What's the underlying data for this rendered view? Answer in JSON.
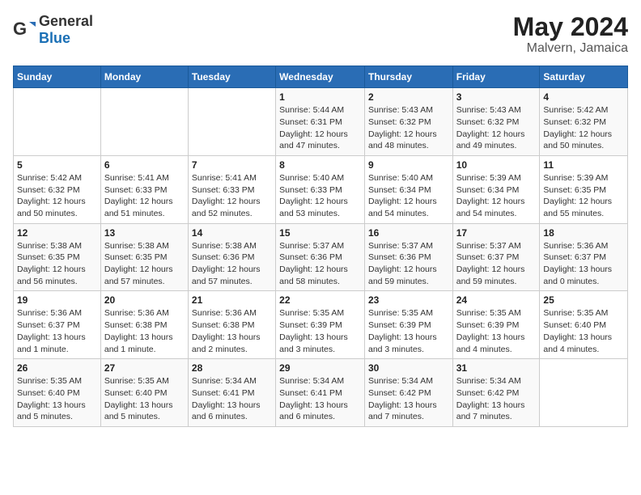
{
  "header": {
    "logo_general": "General",
    "logo_blue": "Blue",
    "month": "May 2024",
    "location": "Malvern, Jamaica"
  },
  "days_of_week": [
    "Sunday",
    "Monday",
    "Tuesday",
    "Wednesday",
    "Thursday",
    "Friday",
    "Saturday"
  ],
  "weeks": [
    [
      {
        "day": "",
        "info": ""
      },
      {
        "day": "",
        "info": ""
      },
      {
        "day": "",
        "info": ""
      },
      {
        "day": "1",
        "info": "Sunrise: 5:44 AM\nSunset: 6:31 PM\nDaylight: 12 hours\nand 47 minutes."
      },
      {
        "day": "2",
        "info": "Sunrise: 5:43 AM\nSunset: 6:32 PM\nDaylight: 12 hours\nand 48 minutes."
      },
      {
        "day": "3",
        "info": "Sunrise: 5:43 AM\nSunset: 6:32 PM\nDaylight: 12 hours\nand 49 minutes."
      },
      {
        "day": "4",
        "info": "Sunrise: 5:42 AM\nSunset: 6:32 PM\nDaylight: 12 hours\nand 50 minutes."
      }
    ],
    [
      {
        "day": "5",
        "info": "Sunrise: 5:42 AM\nSunset: 6:32 PM\nDaylight: 12 hours\nand 50 minutes."
      },
      {
        "day": "6",
        "info": "Sunrise: 5:41 AM\nSunset: 6:33 PM\nDaylight: 12 hours\nand 51 minutes."
      },
      {
        "day": "7",
        "info": "Sunrise: 5:41 AM\nSunset: 6:33 PM\nDaylight: 12 hours\nand 52 minutes."
      },
      {
        "day": "8",
        "info": "Sunrise: 5:40 AM\nSunset: 6:33 PM\nDaylight: 12 hours\nand 53 minutes."
      },
      {
        "day": "9",
        "info": "Sunrise: 5:40 AM\nSunset: 6:34 PM\nDaylight: 12 hours\nand 54 minutes."
      },
      {
        "day": "10",
        "info": "Sunrise: 5:39 AM\nSunset: 6:34 PM\nDaylight: 12 hours\nand 54 minutes."
      },
      {
        "day": "11",
        "info": "Sunrise: 5:39 AM\nSunset: 6:35 PM\nDaylight: 12 hours\nand 55 minutes."
      }
    ],
    [
      {
        "day": "12",
        "info": "Sunrise: 5:38 AM\nSunset: 6:35 PM\nDaylight: 12 hours\nand 56 minutes."
      },
      {
        "day": "13",
        "info": "Sunrise: 5:38 AM\nSunset: 6:35 PM\nDaylight: 12 hours\nand 57 minutes."
      },
      {
        "day": "14",
        "info": "Sunrise: 5:38 AM\nSunset: 6:36 PM\nDaylight: 12 hours\nand 57 minutes."
      },
      {
        "day": "15",
        "info": "Sunrise: 5:37 AM\nSunset: 6:36 PM\nDaylight: 12 hours\nand 58 minutes."
      },
      {
        "day": "16",
        "info": "Sunrise: 5:37 AM\nSunset: 6:36 PM\nDaylight: 12 hours\nand 59 minutes."
      },
      {
        "day": "17",
        "info": "Sunrise: 5:37 AM\nSunset: 6:37 PM\nDaylight: 12 hours\nand 59 minutes."
      },
      {
        "day": "18",
        "info": "Sunrise: 5:36 AM\nSunset: 6:37 PM\nDaylight: 13 hours\nand 0 minutes."
      }
    ],
    [
      {
        "day": "19",
        "info": "Sunrise: 5:36 AM\nSunset: 6:37 PM\nDaylight: 13 hours\nand 1 minute."
      },
      {
        "day": "20",
        "info": "Sunrise: 5:36 AM\nSunset: 6:38 PM\nDaylight: 13 hours\nand 1 minute."
      },
      {
        "day": "21",
        "info": "Sunrise: 5:36 AM\nSunset: 6:38 PM\nDaylight: 13 hours\nand 2 minutes."
      },
      {
        "day": "22",
        "info": "Sunrise: 5:35 AM\nSunset: 6:39 PM\nDaylight: 13 hours\nand 3 minutes."
      },
      {
        "day": "23",
        "info": "Sunrise: 5:35 AM\nSunset: 6:39 PM\nDaylight: 13 hours\nand 3 minutes."
      },
      {
        "day": "24",
        "info": "Sunrise: 5:35 AM\nSunset: 6:39 PM\nDaylight: 13 hours\nand 4 minutes."
      },
      {
        "day": "25",
        "info": "Sunrise: 5:35 AM\nSunset: 6:40 PM\nDaylight: 13 hours\nand 4 minutes."
      }
    ],
    [
      {
        "day": "26",
        "info": "Sunrise: 5:35 AM\nSunset: 6:40 PM\nDaylight: 13 hours\nand 5 minutes."
      },
      {
        "day": "27",
        "info": "Sunrise: 5:35 AM\nSunset: 6:40 PM\nDaylight: 13 hours\nand 5 minutes."
      },
      {
        "day": "28",
        "info": "Sunrise: 5:34 AM\nSunset: 6:41 PM\nDaylight: 13 hours\nand 6 minutes."
      },
      {
        "day": "29",
        "info": "Sunrise: 5:34 AM\nSunset: 6:41 PM\nDaylight: 13 hours\nand 6 minutes."
      },
      {
        "day": "30",
        "info": "Sunrise: 5:34 AM\nSunset: 6:42 PM\nDaylight: 13 hours\nand 7 minutes."
      },
      {
        "day": "31",
        "info": "Sunrise: 5:34 AM\nSunset: 6:42 PM\nDaylight: 13 hours\nand 7 minutes."
      },
      {
        "day": "",
        "info": ""
      }
    ]
  ]
}
